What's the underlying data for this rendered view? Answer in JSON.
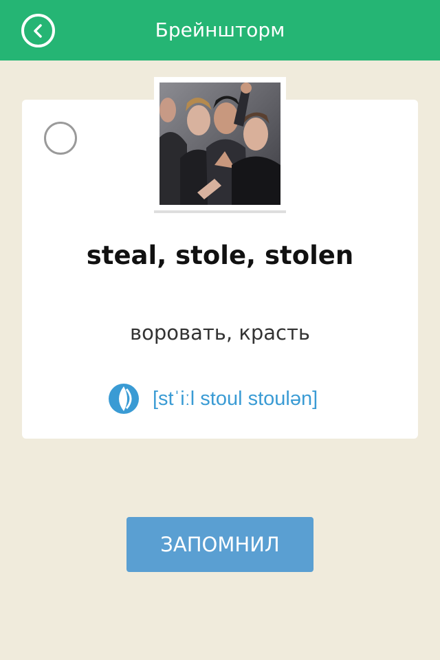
{
  "header": {
    "title": "Брейншторм",
    "back_icon": "chevron-left-circle-icon",
    "background_color": "#25b574"
  },
  "card": {
    "checkbox_state": "unchecked",
    "image": "band-photo",
    "word": "steal, stole, stolen",
    "translation": "воровать, красть",
    "sound_icon": "speaker-icon",
    "transcription": "[stˈiːl stoul stoulən]"
  },
  "actions": {
    "remember_label": "ЗАПОМНИЛ",
    "button_color": "#5a9fd2"
  }
}
